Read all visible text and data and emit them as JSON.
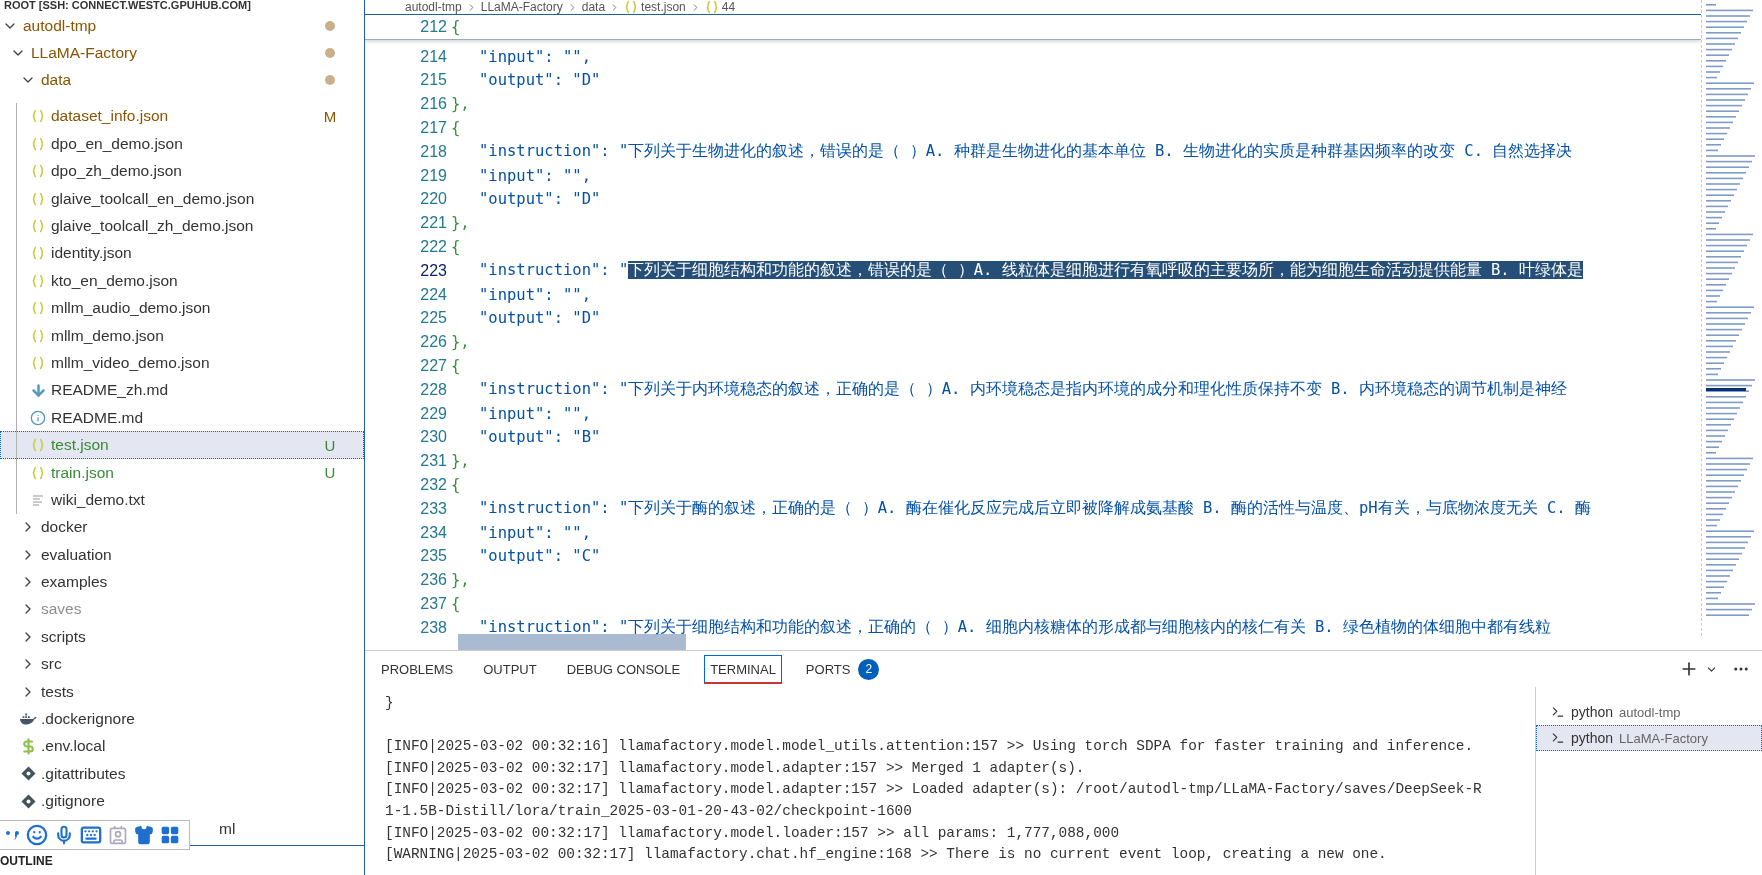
{
  "explorer": {
    "title": "ROOT [SSH: CONNECT.WESTC.GPUHUB.COM]",
    "tree": [
      {
        "label": "autodl-tmp",
        "kind": "folder",
        "expanded": true,
        "color": "#895503",
        "dot": true,
        "children": [
          {
            "label": "LLaMA-Factory",
            "kind": "folder",
            "expanded": true,
            "color": "#895503",
            "dot": true,
            "children": [
              {
                "label": "data",
                "kind": "folder",
                "expanded": true,
                "color": "#895503",
                "dot": true,
                "children": [
                  {
                    "label": "dataset_info.json",
                    "kind": "json",
                    "color": "#895503",
                    "badge": "M"
                  },
                  {
                    "label": "dpo_en_demo.json",
                    "kind": "json"
                  },
                  {
                    "label": "dpo_zh_demo.json",
                    "kind": "json"
                  },
                  {
                    "label": "glaive_toolcall_en_demo.json",
                    "kind": "json"
                  },
                  {
                    "label": "glaive_toolcall_zh_demo.json",
                    "kind": "json"
                  },
                  {
                    "label": "identity.json",
                    "kind": "json"
                  },
                  {
                    "label": "kto_en_demo.json",
                    "kind": "json"
                  },
                  {
                    "label": "mllm_audio_demo.json",
                    "kind": "json"
                  },
                  {
                    "label": "mllm_demo.json",
                    "kind": "json"
                  },
                  {
                    "label": "mllm_video_demo.json",
                    "kind": "json"
                  },
                  {
                    "label": "README_zh.md",
                    "kind": "markdown"
                  },
                  {
                    "label": "README.md",
                    "kind": "info"
                  },
                  {
                    "label": "test.json",
                    "kind": "json",
                    "color": "#388a34",
                    "badge": "U",
                    "selected": true
                  },
                  {
                    "label": "train.json",
                    "kind": "json",
                    "color": "#388a34",
                    "badge": "U"
                  },
                  {
                    "label": "wiki_demo.txt",
                    "kind": "text"
                  }
                ]
              },
              {
                "label": "docker",
                "kind": "folder",
                "expanded": false
              },
              {
                "label": "evaluation",
                "kind": "folder",
                "expanded": false
              },
              {
                "label": "examples",
                "kind": "folder",
                "expanded": false
              },
              {
                "label": "saves",
                "kind": "folder",
                "expanded": false,
                "color": "#8e8e90"
              },
              {
                "label": "scripts",
                "kind": "folder",
                "expanded": false
              },
              {
                "label": "src",
                "kind": "folder",
                "expanded": false
              },
              {
                "label": "tests",
                "kind": "folder",
                "expanded": false
              },
              {
                "label": ".dockerignore",
                "kind": "docker"
              },
              {
                "label": ".env.local",
                "kind": "env"
              },
              {
                "label": ".gitattributes",
                "kind": "git"
              },
              {
                "label": ".gitignore",
                "kind": "git"
              },
              {
                "label": "ml",
                "kind": "file",
                "covered": true
              }
            ]
          }
        ]
      }
    ],
    "outline": "OUTLINE"
  },
  "breadcrumb": [
    "autodl-tmp",
    "LLaMA-Factory",
    "data",
    "test.json",
    "44"
  ],
  "editor": {
    "sticky": {
      "num": "212",
      "kind": "open",
      "text": "{"
    },
    "lines": [
      {
        "num": "214",
        "kind": "key",
        "text": "\"input\": \"\","
      },
      {
        "num": "215",
        "kind": "key",
        "text": "\"output\": \"D\""
      },
      {
        "num": "216",
        "kind": "close",
        "text": "},"
      },
      {
        "num": "217",
        "kind": "open",
        "text": "{"
      },
      {
        "num": "218",
        "kind": "key",
        "text": "\"instruction\": \"下列关于生物进化的叙述，错误的是（  ）A. 种群是生物进化的基本单位 B. 生物进化的实质是种群基因频率的改变 C. 自然选择决"
      },
      {
        "num": "219",
        "kind": "key",
        "text": "\"input\": \"\","
      },
      {
        "num": "220",
        "kind": "key",
        "text": "\"output\": \"D\""
      },
      {
        "num": "221",
        "kind": "close",
        "text": "},"
      },
      {
        "num": "222",
        "kind": "open",
        "text": "{"
      },
      {
        "num": "223",
        "kind": "key",
        "current": true,
        "text": "\"instruction\": \"",
        "selected_text": "下列关于细胞结构和功能的叙述，错误的是（  ）A. 线粒体是细胞进行有氧呼吸的主要场所，能为细胞生命活动提供能量 B. 叶绿体是"
      },
      {
        "num": "224",
        "kind": "key",
        "text": "\"input\": \"\","
      },
      {
        "num": "225",
        "kind": "key",
        "text": "\"output\": \"D\""
      },
      {
        "num": "226",
        "kind": "close",
        "text": "},"
      },
      {
        "num": "227",
        "kind": "open",
        "text": "{"
      },
      {
        "num": "228",
        "kind": "key",
        "text": "\"instruction\": \"下列关于内环境稳态的叙述，正确的是（  ）A. 内环境稳态是指内环境的成分和理化性质保持不变 B. 内环境稳态的调节机制是神经"
      },
      {
        "num": "229",
        "kind": "key",
        "text": "\"input\": \"\","
      },
      {
        "num": "230",
        "kind": "key",
        "text": "\"output\": \"B\""
      },
      {
        "num": "231",
        "kind": "close",
        "text": "},"
      },
      {
        "num": "232",
        "kind": "open",
        "text": "{"
      },
      {
        "num": "233",
        "kind": "key",
        "text": "\"instruction\": \"下列关于酶的叙述，正确的是（  ）A. 酶在催化反应完成后立即被降解成氨基酸 B. 酶的活性与温度、pH有关，与底物浓度无关 C. 酶"
      },
      {
        "num": "234",
        "kind": "key",
        "text": "\"input\": \"\","
      },
      {
        "num": "235",
        "kind": "key",
        "text": "\"output\": \"C\""
      },
      {
        "num": "236",
        "kind": "close",
        "text": "},"
      },
      {
        "num": "237",
        "kind": "open",
        "text": "{"
      },
      {
        "num": "238",
        "kind": "key",
        "text": "\"instruction\": \"下列关于细胞结构和功能的叙述，正确的（    ）A. 细胞内核糖体的形成都与细胞核内的核仁有关 B. 绿色植物的体细胞中都有线粒"
      }
    ]
  },
  "panel": {
    "tabs": [
      {
        "label": "PROBLEMS",
        "selected": false
      },
      {
        "label": "OUTPUT",
        "selected": false
      },
      {
        "label": "DEBUG CONSOLE",
        "selected": false
      },
      {
        "label": "TERMINAL",
        "selected": true
      },
      {
        "label": "PORTS",
        "selected": false,
        "badge": "2"
      }
    ],
    "terminal_lines": [
      "}",
      "[INFO|2025-03-02 00:32:16] llamafactory.model.model_utils.attention:157 >> Using torch SDPA for faster training and inference.",
      "[INFO|2025-03-02 00:32:17] llamafactory.model.adapter:157 >> Merged 1 adapter(s).",
      "[INFO|2025-03-02 00:32:17] llamafactory.model.adapter:157 >> Loaded adapter(s): /root/autodl-tmp/LLaMA-Factory/saves/DeepSeek-R",
      "1-1.5B-Distill/lora/train_2025-03-01-20-43-02/checkpoint-1600",
      "[INFO|2025-03-02 00:32:17] llamafactory.model.loader:157 >> all params: 1,777,088,000",
      "[WARNING|2025-03-02 00:32:17] llamafactory.chat.hf_engine:168 >> There is no current event loop, creating a new one."
    ],
    "terminals": [
      {
        "name": "python",
        "folder": "autodl-tmp",
        "selected": false
      },
      {
        "name": "python",
        "folder": "LLaMA-Factory",
        "selected": true
      }
    ]
  }
}
